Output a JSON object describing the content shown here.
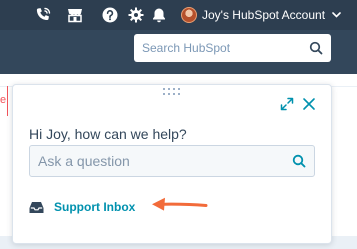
{
  "topbar": {
    "account_label": "Joy's HubSpot Account",
    "icons": [
      "calling-icon",
      "marketplace-icon",
      "help-icon",
      "settings-icon",
      "notifications-icon",
      "chevron-down-icon"
    ]
  },
  "search": {
    "placeholder": "Search HubSpot"
  },
  "help_widget": {
    "greeting": "Hi Joy, how can we help?",
    "ask_placeholder": "Ask a question",
    "support_inbox_label": "Support Inbox"
  },
  "background": {
    "fragment_letter": "e"
  },
  "colors": {
    "nav_dark": "#2d3e50",
    "subnav": "#33475b",
    "link_teal": "#0091ae",
    "arrow_orange": "#f26b3a",
    "text_dark": "#33475b"
  }
}
